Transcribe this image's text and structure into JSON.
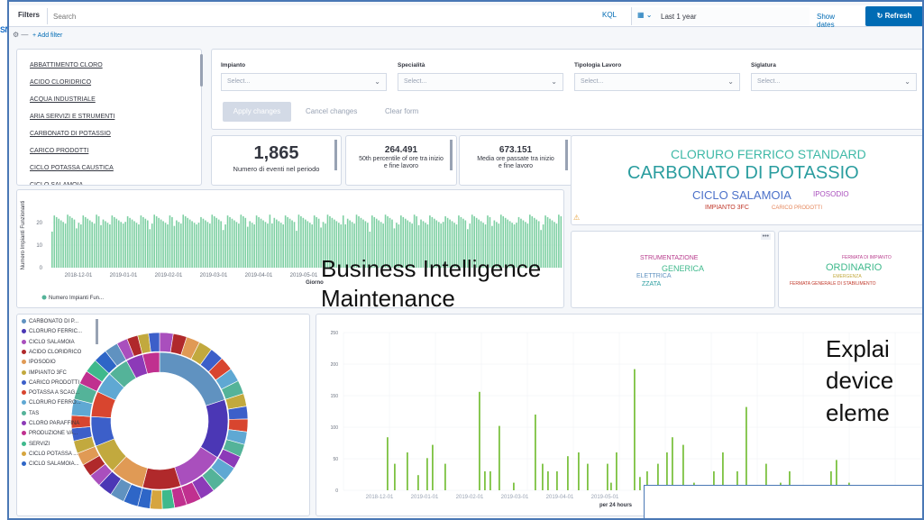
{
  "app": {
    "logo_text": "SNA"
  },
  "filterbar": {
    "label": "Filters",
    "search_placeholder": "Search",
    "kql": "KQL",
    "date_value": "Last 1 year",
    "show_dates": "Show dates",
    "refresh": "Refresh",
    "add_filter": "+ Add filter"
  },
  "list": [
    "ABBATTIMENTO CLORO",
    "ACIDO CLORIDRICO",
    "ACQUA INDUSTRIALE",
    "ARIA SERVIZI E STRUMENTI",
    "CARBONATO DI POTASSIO",
    "CARICO PRODOTTI",
    "CICLO POTASSA CAUSTICA",
    "CICLO SALAMOIA"
  ],
  "controls": {
    "dropdowns": [
      {
        "label": "Impianto",
        "placeholder": "Select..."
      },
      {
        "label": "Specialità",
        "placeholder": "Select..."
      },
      {
        "label": "Tipologia Lavoro",
        "placeholder": "Select..."
      },
      {
        "label": "Siglatura",
        "placeholder": "Select..."
      }
    ],
    "apply": "Apply changes",
    "cancel": "Cancel changes",
    "clear": "Clear form"
  },
  "metrics": [
    {
      "value": "1,865",
      "label": "Numero di eventi nel periodo"
    },
    {
      "value": "264.491",
      "label": "50th percentile of ore tra inizio e fine lavoro"
    },
    {
      "value": "673.151",
      "label": "Media ore passate tra inizio e fine lavoro"
    }
  ],
  "tagcloud1": [
    {
      "text": "CLORURO FERRICO STANDARD",
      "color": "#3fb9a7"
    },
    {
      "text": "CARBONATO DI POTASSIO",
      "color": "#2a9d9f"
    },
    {
      "text": "CICLO SALAMOIA",
      "color": "#4c71c9"
    },
    {
      "text": "IPOSODIO",
      "color": "#a94fbd"
    },
    {
      "text": "IMPIANTO 3FC",
      "color": "#c0392b"
    },
    {
      "text": "CARICO PRODOTTI",
      "color": "#e5865b"
    }
  ],
  "tagcloud2": [
    {
      "text": "STRUMENTAZIONE",
      "color": "#b83c8d"
    },
    {
      "text": "GENERICA",
      "color": "#3fb98c"
    },
    {
      "text": "ELETTRICA",
      "color": "#6092c0"
    },
    {
      "text": "ZZATA",
      "color": "#2a9d9f"
    }
  ],
  "tagcloud3": [
    {
      "text": "FERMATA DI IMPIANTO",
      "color": "#b83c8d"
    },
    {
      "text": "ORDINARIO",
      "color": "#3fb98c"
    },
    {
      "text": "EMERGENZA",
      "color": "#c2a93e"
    },
    {
      "text": "FERMATA GENERALE DI STABILIMENTO",
      "color": "#c0392b"
    }
  ],
  "bar_chart": {
    "ylabel": "Numero Impianti Funzionanti",
    "xlabel": "Giorno",
    "legend": "Numero Impianti Fun...",
    "yticks": [
      "0",
      "10",
      "20"
    ],
    "xticks": [
      "2018-12-01",
      "2019-01-01",
      "2019-02-01",
      "2019-03-01",
      "2019-04-01",
      "2019-05-01"
    ]
  },
  "donut_legend": [
    {
      "label": "CARBONATO DI P...",
      "color": "#6092c0"
    },
    {
      "label": "CLORURO FERRIC...",
      "color": "#4b37b5"
    },
    {
      "label": "CICLO SALAMOIA",
      "color": "#a94fbd"
    },
    {
      "label": "ACIDO CLORIDRICO",
      "color": "#b0292b"
    },
    {
      "label": "IPOSODIO",
      "color": "#e09a55"
    },
    {
      "label": "IMPIANTO 3FC",
      "color": "#c2a93e"
    },
    {
      "label": "CARICO PRODOTTI",
      "color": "#3c5fc9"
    },
    {
      "label": "POTASSA A SCAG...",
      "color": "#d8452f"
    },
    {
      "label": "CLORURO FERRO...",
      "color": "#5fa8d3"
    },
    {
      "label": "TAS",
      "color": "#54b399"
    },
    {
      "label": "CLORO PARAFFINA",
      "color": "#8c3ab8"
    },
    {
      "label": "PRODUZIONE VA...",
      "color": "#c0308f"
    },
    {
      "label": "SERVIZI",
      "color": "#3fb98c"
    },
    {
      "label": "CICLO POTASSA ...",
      "color": "#d6a53e"
    },
    {
      "label": "CICLO SALAMOIA...",
      "color": "#2e66c7"
    }
  ],
  "spike_chart": {
    "yticks": [
      "0",
      "50",
      "100",
      "150",
      "200",
      "250"
    ],
    "xticks": [
      "2018-12-01",
      "2019-01-01",
      "2019-02-01",
      "2019-03-01",
      "2019-04-01",
      "2019-05-01"
    ],
    "xlabel": "per 24 hours"
  },
  "overlay": {
    "title_line1": "Business Intelligence",
    "title_line2": "Maintenance",
    "side_line1": "Explai",
    "side_line2": "device",
    "side_line3": "eleme"
  }
}
